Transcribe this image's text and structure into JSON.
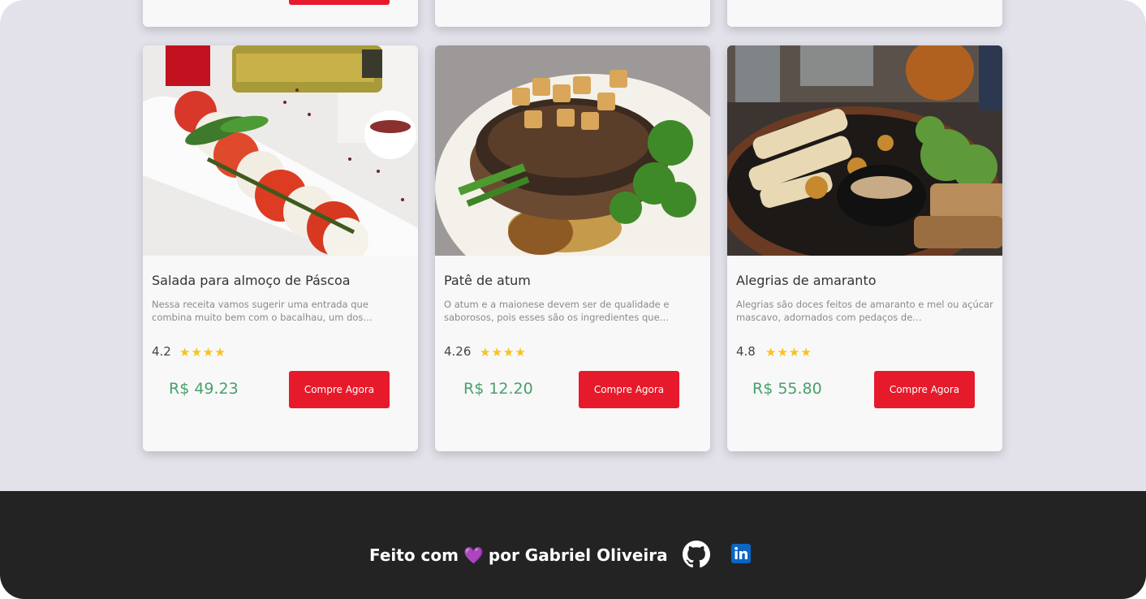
{
  "products": [
    {
      "title": "Salada para almoço de Páscoa",
      "description": "Nessa receita vamos sugerir uma entrada que combina muito bem com o bacalhau, um dos…",
      "rating": "4.2",
      "stars": "★★★★",
      "price": "R$ 49.23",
      "button": "Compre Agora"
    },
    {
      "title": "Patê de atum",
      "description": "O atum e a maionese devem ser de qualidade e saborosos, pois esses são os ingredientes que…",
      "rating": "4.26",
      "stars": "★★★★",
      "price": "R$ 12.20",
      "button": "Compre Agora"
    },
    {
      "title": "Alegrias de amaranto",
      "description": "Alegrias são doces feitos de amaranto e mel ou açúcar mascavo, adornados com pedaços de…",
      "rating": "4.8",
      "stars": "★★★★",
      "price": "R$ 55.80",
      "button": "Compre Agora"
    }
  ],
  "footer": {
    "text_before": "Feito com",
    "heart": "💜",
    "text_after": "por Gabriel Oliveira",
    "icons": [
      "github-icon",
      "linkedin-icon"
    ]
  },
  "colors": {
    "background": "#e3e2ea",
    "card": "#f8f8f9",
    "button": "#e61a2b",
    "price": "#48a06a",
    "star": "#f6c31b",
    "footer": "#232323"
  }
}
